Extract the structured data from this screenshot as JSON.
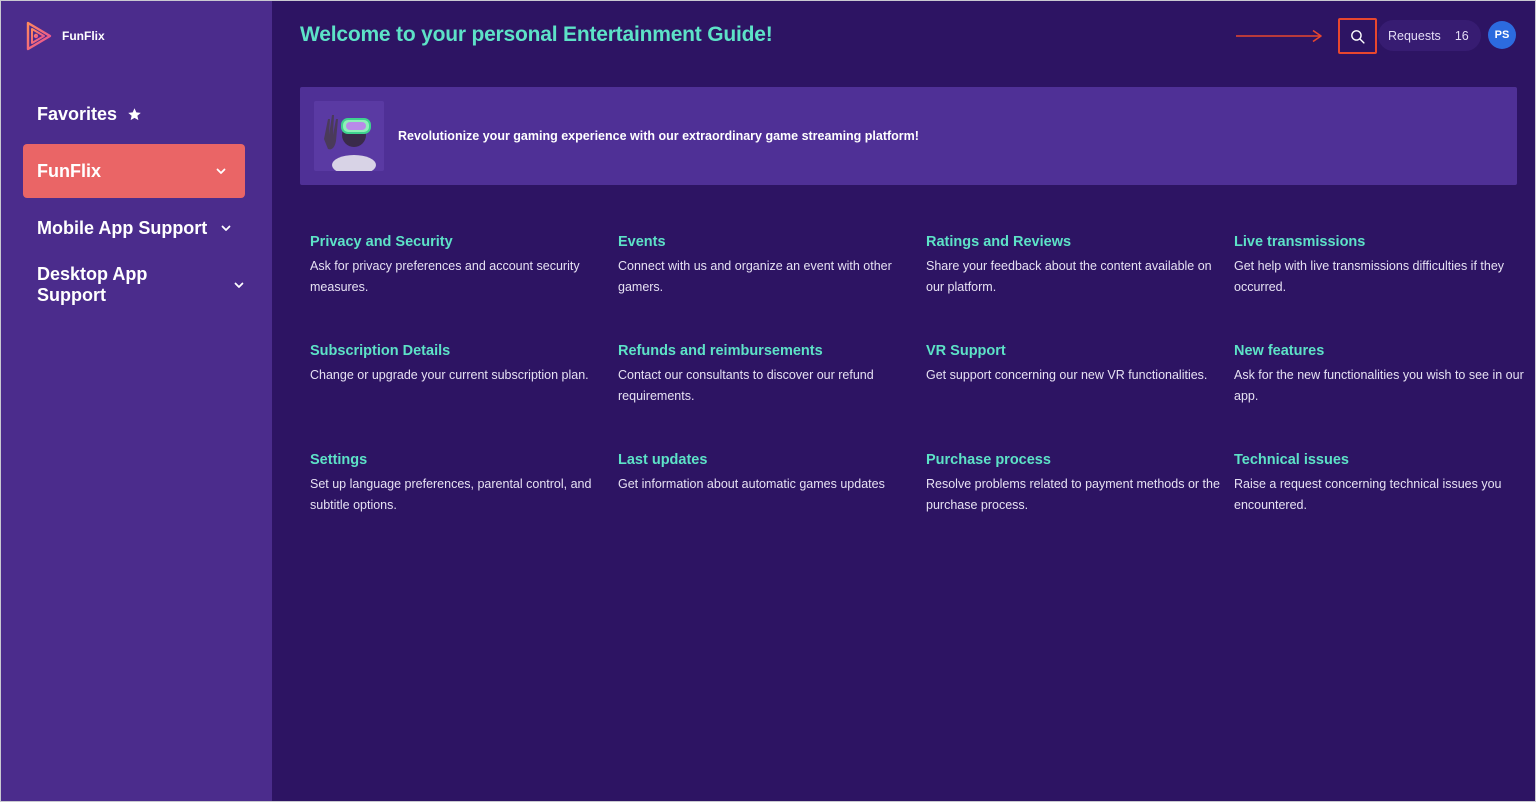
{
  "app": {
    "name": "FunFlix"
  },
  "sidebar": {
    "items": [
      {
        "label": "Favorites",
        "icon": "star-icon"
      },
      {
        "label": "FunFlix",
        "icon": "chevron-down-icon",
        "active": true
      },
      {
        "label": "Mobile App Support",
        "icon": "chevron-down-icon"
      },
      {
        "label": "Desktop App Support",
        "icon": "chevron-down-icon"
      }
    ]
  },
  "header": {
    "title": "Welcome to your personal Entertainment Guide!",
    "requests_label": "Requests",
    "requests_count": "16",
    "avatar_initials": "PS"
  },
  "banner": {
    "text": "Revolutionize your gaming experience with our extraordinary game streaming platform!"
  },
  "categories": [
    {
      "title": "Privacy and Security",
      "desc": "Ask for privacy preferences and account security measures."
    },
    {
      "title": "Events",
      "desc": "Connect with us and organize an event with other gamers."
    },
    {
      "title": "Ratings and Reviews",
      "desc": "Share your feedback about the content available on our platform."
    },
    {
      "title": "Live transmissions",
      "desc": "Get help with live transmissions difficulties if they occurred."
    },
    {
      "title": "Subscription Details",
      "desc": "Change or upgrade your current subscription plan."
    },
    {
      "title": "Refunds and reimbursements",
      "desc": "Contact our consultants to discover our refund requirements."
    },
    {
      "title": "VR Support",
      "desc": "Get support concerning our new VR functionalities."
    },
    {
      "title": "New features",
      "desc": "Ask for the new functionalities you wish to see in our app."
    },
    {
      "title": "Settings",
      "desc": "Set up language preferences, parental control, and subtitle options."
    },
    {
      "title": "Last updates",
      "desc": "Get information about automatic games updates"
    },
    {
      "title": "Purchase process",
      "desc": "Resolve problems related to payment methods or the purchase process."
    },
    {
      "title": "Technical issues",
      "desc": "Raise a request concerning technical issues you encountered."
    }
  ],
  "colors": {
    "sidebar_bg": "#4b2c8c",
    "main_bg": "#2d1463",
    "accent_teal": "#5de2c7",
    "active_item": "#ea6566",
    "highlight_red": "#e8472e"
  }
}
